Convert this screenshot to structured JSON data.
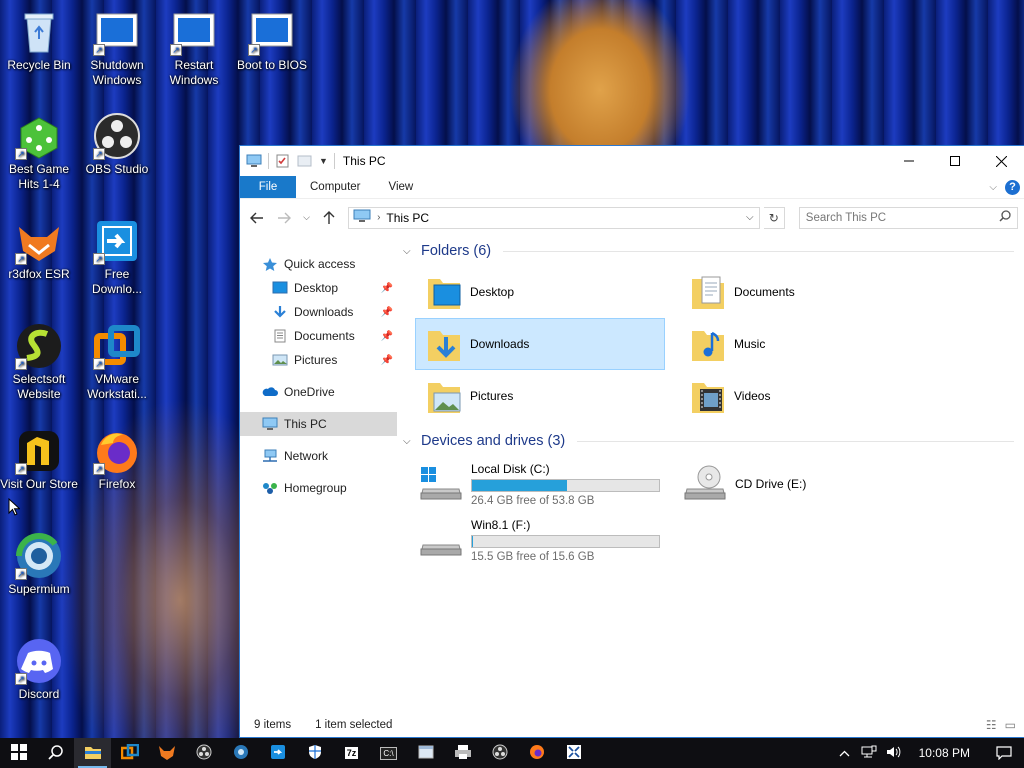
{
  "desktop_icons": [
    {
      "label": "Recycle Bin",
      "icon": "recycle-bin-icon"
    },
    {
      "label": "Shutdown Windows",
      "icon": "shortcut-window-icon"
    },
    {
      "label": "Restart Windows",
      "icon": "shortcut-window-icon"
    },
    {
      "label": "Boot to BIOS",
      "icon": "shortcut-window-icon"
    },
    {
      "label": "Best Game Hits 1-4",
      "icon": "dice-icon"
    },
    {
      "label": "OBS Studio",
      "icon": "obs-icon"
    },
    {
      "label": "r3dfox ESR",
      "icon": "fox-icon"
    },
    {
      "label": "Free Downlo...",
      "icon": "download-app-icon"
    },
    {
      "label": "Selectsoft Website",
      "icon": "selectsoft-icon"
    },
    {
      "label": "VMware Workstati...",
      "icon": "vmware-icon"
    },
    {
      "label": "Visit Our Store",
      "icon": "store-icon"
    },
    {
      "label": "Firefox",
      "icon": "firefox-icon"
    },
    {
      "label": "Supermium",
      "icon": "supermium-icon"
    },
    {
      "label": "Discord",
      "icon": "discord-icon"
    }
  ],
  "window": {
    "title": "This PC",
    "ribbon_tabs": {
      "file": "File",
      "computer": "Computer",
      "view": "View"
    },
    "address": {
      "path": "This PC"
    },
    "search": {
      "placeholder": "Search This PC"
    },
    "nav": {
      "quick_access": "Quick access",
      "desktop": "Desktop",
      "downloads": "Downloads",
      "documents": "Documents",
      "pictures": "Pictures",
      "onedrive": "OneDrive",
      "this_pc": "This PC",
      "network": "Network",
      "homegroup": "Homegroup"
    },
    "folders_header": "Folders (6)",
    "folders": {
      "desktop": "Desktop",
      "documents": "Documents",
      "downloads": "Downloads",
      "music": "Music",
      "pictures": "Pictures",
      "videos": "Videos"
    },
    "drives_header": "Devices and drives (3)",
    "drives": {
      "c": {
        "name": "Local Disk (C:)",
        "free": "26.4 GB free of 53.8 GB",
        "used_fraction": 0.51
      },
      "f": {
        "name": "Win8.1 (F:)",
        "free": "15.5 GB free of 15.6 GB",
        "used_fraction": 0.006
      },
      "e": {
        "name": "CD Drive (E:)"
      }
    },
    "status": {
      "count": "9 items",
      "selected": "1 item selected"
    }
  },
  "taskbar": {
    "clock": "10:08 PM",
    "apps": [
      "start-icon",
      "search-icon",
      "file-explorer-icon",
      "app-icon",
      "fox-icon",
      "obs-icon",
      "supermium-icon",
      "download-app-icon",
      "shield-icon",
      "7zip-icon",
      "cmd-icon",
      "window-icon",
      "printer-icon",
      "obs-icon",
      "firefox-icon",
      "app-icon"
    ]
  },
  "colors": {
    "accent": "#1979ca",
    "selection": "#cce8ff",
    "drive_fill": "#26a0da",
    "taskbar": "#0e0e12"
  }
}
